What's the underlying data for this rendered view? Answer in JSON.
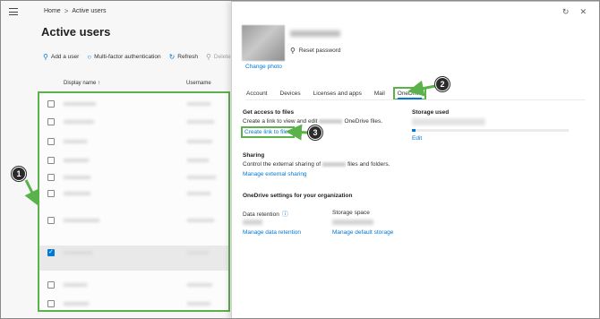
{
  "breadcrumb": {
    "home": "Home",
    "separator": ">",
    "current": "Active users"
  },
  "page_title": "Active users",
  "commands": [
    {
      "label": "Add a user",
      "icon": "person-add-icon",
      "glyph": "⍝"
    },
    {
      "label": "Multi-factor authentication",
      "icon": "lock-icon",
      "glyph": "🔒︎"
    },
    {
      "label": "Refresh",
      "icon": "refresh-icon",
      "glyph": "↻"
    },
    {
      "label": "Delete user",
      "icon": "person-delete-icon",
      "glyph": "⍝",
      "disabled": true
    }
  ],
  "list": {
    "columns": [
      "Display name ↑",
      "Username"
    ],
    "rows": [
      {
        "checked": false
      },
      {
        "checked": false
      },
      {
        "checked": false
      },
      {
        "checked": false
      },
      {
        "checked": false
      },
      {
        "checked": false
      },
      {
        "checked": false
      },
      {
        "checked": true
      },
      {
        "checked": false
      },
      {
        "checked": false
      }
    ]
  },
  "panel": {
    "reset_password": "Reset password",
    "change_photo": "Change photo",
    "tabs": [
      "Account",
      "Devices",
      "Licenses and apps",
      "Mail",
      "OneDrive"
    ],
    "active_tab": "OneDrive",
    "get_access": {
      "title": "Get access to files",
      "desc_before": "Create a link to view and edit",
      "desc_after": "OneDrive files.",
      "link": "Create link to files"
    },
    "storage": {
      "title": "Storage used",
      "edit": "Edit",
      "used_fraction": 0.02
    },
    "sharing": {
      "title": "Sharing",
      "desc_before": "Control the external sharing of",
      "desc_after": "files and folders.",
      "link": "Manage external sharing"
    },
    "org_settings": {
      "title": "OneDrive settings for your organization",
      "retention_label": "Data retention",
      "retention_link": "Manage data retention",
      "storage_label": "Storage space",
      "storage_link": "Manage default storage"
    }
  },
  "callouts": [
    "1",
    "2",
    "3"
  ],
  "colors": {
    "accent": "#0078d4",
    "highlight": "#5bb14a",
    "badge": "#2b2b2b"
  }
}
